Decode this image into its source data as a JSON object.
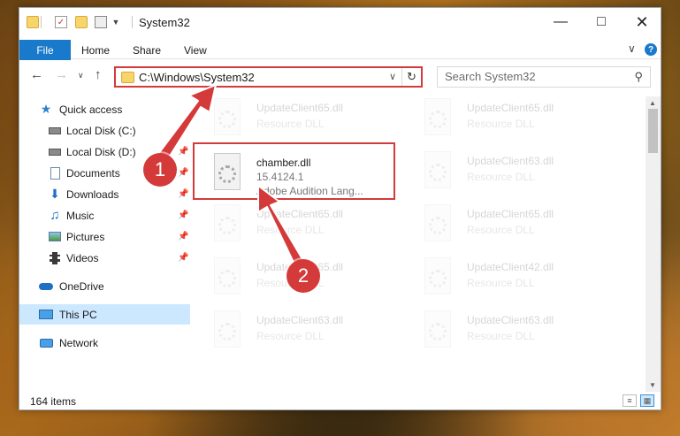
{
  "window": {
    "title": "System32"
  },
  "ribbon": {
    "file": "File",
    "tabs": [
      "Home",
      "Share",
      "View"
    ]
  },
  "nav": {
    "address": "C:\\Windows\\System32",
    "search_placeholder": "Search System32"
  },
  "sidebar": {
    "items": [
      {
        "label": "Quick access",
        "icon": "star-icon",
        "pinned": false
      },
      {
        "label": "Local Disk (C:)",
        "icon": "drive-icon",
        "pinned": true
      },
      {
        "label": "Local Disk (D:)",
        "icon": "drive-icon",
        "pinned": true
      },
      {
        "label": "Documents",
        "icon": "documents-icon",
        "pinned": true
      },
      {
        "label": "Downloads",
        "icon": "download-icon",
        "pinned": true
      },
      {
        "label": "Music",
        "icon": "music-icon",
        "pinned": true
      },
      {
        "label": "Pictures",
        "icon": "pictures-icon",
        "pinned": true
      },
      {
        "label": "Videos",
        "icon": "videos-icon",
        "pinned": true
      },
      {
        "label": "OneDrive",
        "icon": "cloud-icon",
        "pinned": false
      },
      {
        "label": "This PC",
        "icon": "computer-icon",
        "pinned": false,
        "selected": true
      },
      {
        "label": "Network",
        "icon": "network-icon",
        "pinned": false
      }
    ]
  },
  "files": {
    "left": [
      {
        "name": "UpdateClient65.dll",
        "desc": "Resource DLL"
      },
      {
        "name": "chamber.dll",
        "version": "15.4124.1",
        "desc": "Adobe Audition Lang..."
      },
      {
        "name": "UpdateClient65.dll",
        "desc": "Resource DLL"
      },
      {
        "name": "UpdateClient65.dll",
        "desc": "Resource DLL"
      },
      {
        "name": "UpdateClient63.dll",
        "desc": "Resource DLL"
      }
    ],
    "right": [
      {
        "name": "UpdateClient65.dll",
        "desc": "Resource DLL"
      },
      {
        "name": "UpdateClient63.dll",
        "desc": "Resource DLL"
      },
      {
        "name": "UpdateClient65.dll",
        "desc": "Resource DLL"
      },
      {
        "name": "UpdateClient42.dll",
        "desc": "Resource DLL"
      },
      {
        "name": "UpdateClient63.dll",
        "desc": "Resource DLL"
      }
    ]
  },
  "status": {
    "items": "164 items"
  },
  "annotations": {
    "badge1": "1",
    "badge2": "2"
  },
  "colors": {
    "accent": "#1979ca",
    "highlight": "#d43a3a",
    "selection": "#cce8ff"
  }
}
